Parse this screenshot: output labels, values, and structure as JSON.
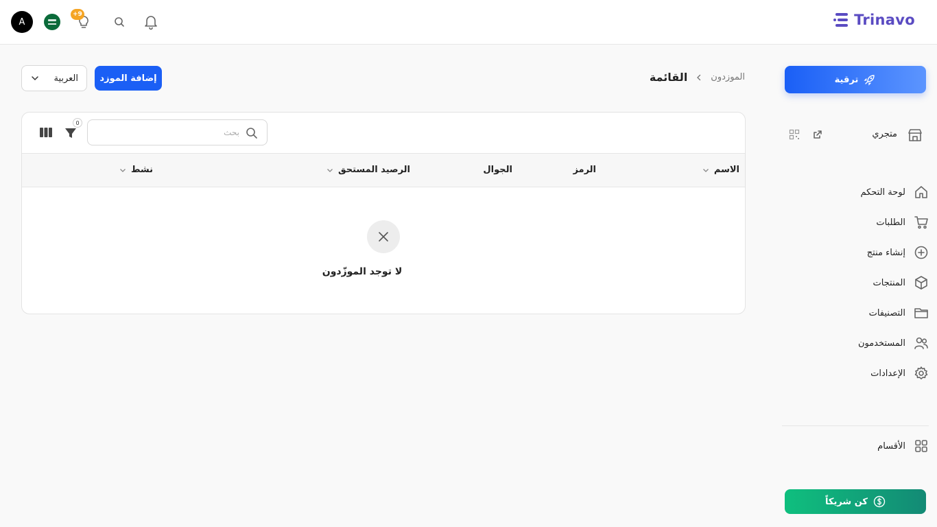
{
  "header": {
    "logo_text": "Trinavo",
    "avatar_initial": "A",
    "hint_badge": "+9",
    "icons": [
      "bell-icon",
      "search-icon",
      "lightbulb-icon",
      "saudi-flag-icon"
    ]
  },
  "breadcrumb": {
    "parent": "الموزدون",
    "separator": ">",
    "current": "القائمة"
  },
  "toolbar": {
    "add_button": "إضافة الموزد",
    "language": "العربية"
  },
  "table": {
    "search_placeholder": "بحث",
    "filter_count": "0",
    "columns": [
      "الاسم",
      "الرمز",
      "الجوال",
      "الرصيد المستحق",
      "نشط"
    ],
    "empty_message": "لا توجد الموزّدون"
  },
  "sidebar": {
    "upgrade_label": "ترقية",
    "store_label": "متجري",
    "items": [
      {
        "label": "لوحة التحكم",
        "icon": "home-icon"
      },
      {
        "label": "الطلبات",
        "icon": "cart-icon"
      },
      {
        "label": "إنشاء منتج",
        "icon": "plus-circle-icon"
      },
      {
        "label": "المنتجات",
        "icon": "box-icon"
      },
      {
        "label": "التصنيفات",
        "icon": "folder-icon"
      },
      {
        "label": "المستخدمون",
        "icon": "users-icon"
      },
      {
        "label": "الإعدادات",
        "icon": "gear-icon"
      }
    ],
    "sections_label": "الأقسام",
    "partner_label": "كن شريكاً"
  },
  "colors": {
    "primary": "#1b5ff5",
    "brand": "#5a4bc2",
    "partner_green": "#0fbf7e",
    "badge_orange": "#f5a524"
  }
}
